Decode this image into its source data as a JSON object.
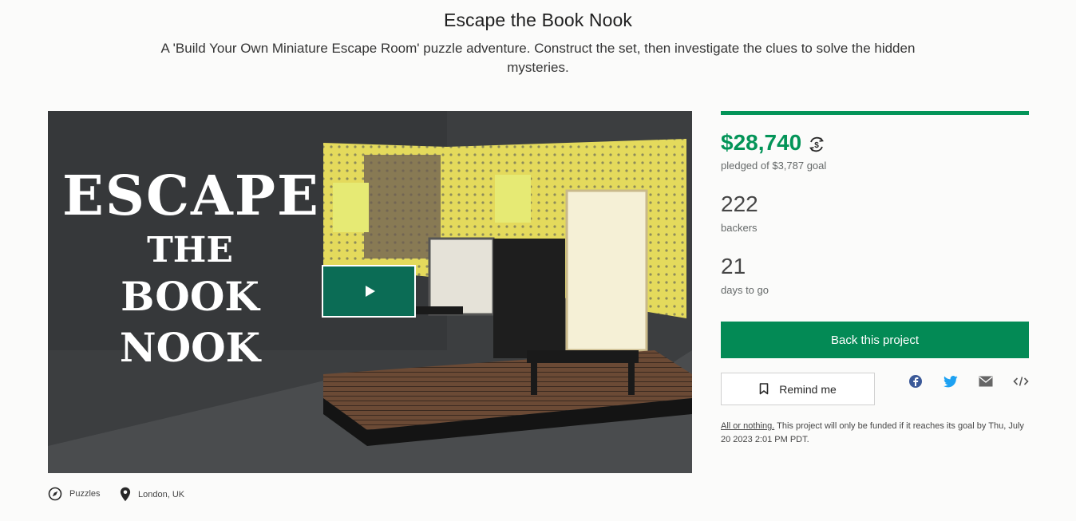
{
  "project": {
    "title": "Escape the Book Nook",
    "subtitle": "A 'Build Your Own Miniature Escape Room' puzzle adventure. Construct the set, then investigate the clues to solve the hidden mysteries."
  },
  "video": {
    "art_lines": [
      "ESCAPE",
      "THE",
      "BOOK NOOK"
    ],
    "play_icon": "play-icon"
  },
  "stats": {
    "funding_progress": 1.0,
    "pledged_amount": "$28,740",
    "pledged_label": "pledged of $3,787 goal",
    "backers_count": "222",
    "backers_label": "backers",
    "days_count": "21",
    "days_label": "days to go"
  },
  "actions": {
    "back_label": "Back this project",
    "remind_label": "Remind me",
    "share_icons": [
      "facebook-icon",
      "twitter-icon",
      "email-icon",
      "embed-icon"
    ]
  },
  "funding_note": {
    "link_text": "All or nothing.",
    "text": " This project will only be funded if it reaches its goal by Thu, July 20 2023 2:01 PM PDT."
  },
  "meta": {
    "category": "Puzzles",
    "location": "London, UK"
  },
  "colors": {
    "accent_green": "#039458",
    "button_green": "#038a55",
    "play_button": "#0b6c55"
  }
}
